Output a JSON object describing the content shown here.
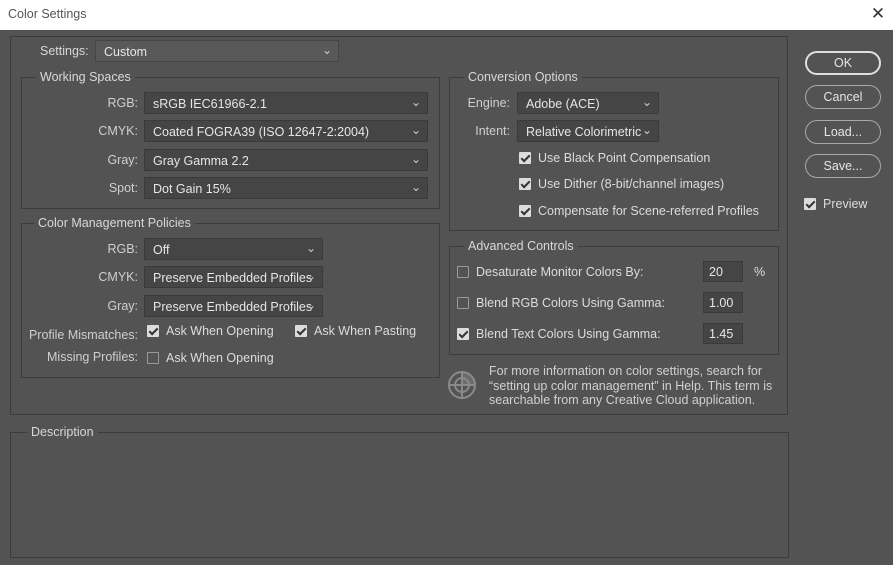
{
  "window": {
    "title": "Color Settings",
    "close_symbol": "✕"
  },
  "settings": {
    "label": "Settings:",
    "value": "Custom"
  },
  "working_spaces": {
    "title": "Working Spaces",
    "rgb": {
      "label": "RGB:",
      "value": "sRGB IEC61966-2.1"
    },
    "cmyk": {
      "label": "CMYK:",
      "value": "Coated FOGRA39 (ISO 12647-2:2004)"
    },
    "gray": {
      "label": "Gray:",
      "value": "Gray Gamma 2.2"
    },
    "spot": {
      "label": "Spot:",
      "value": "Dot Gain 15%"
    }
  },
  "policies": {
    "title": "Color Management Policies",
    "rgb": {
      "label": "RGB:",
      "value": "Off"
    },
    "cmyk": {
      "label": "CMYK:",
      "value": "Preserve Embedded Profiles"
    },
    "gray": {
      "label": "Gray:",
      "value": "Preserve Embedded Profiles"
    },
    "mismatches": {
      "label": "Profile Mismatches:",
      "opening": "Ask When Opening",
      "opening_checked": true,
      "pasting": "Ask When Pasting",
      "pasting_checked": true
    },
    "missing": {
      "label": "Missing Profiles:",
      "opening": "Ask When Opening",
      "opening_checked": false
    }
  },
  "conversion": {
    "title": "Conversion Options",
    "engine": {
      "label": "Engine:",
      "value": "Adobe (ACE)"
    },
    "intent": {
      "label": "Intent:",
      "value": "Relative Colorimetric"
    },
    "black_point": {
      "label": "Use Black Point Compensation",
      "checked": true
    },
    "dither": {
      "label": "Use Dither (8-bit/channel images)",
      "checked": true
    },
    "scene": {
      "label": "Compensate for Scene-referred Profiles",
      "checked": true
    }
  },
  "advanced": {
    "title": "Advanced Controls",
    "desaturate": {
      "label": "Desaturate Monitor Colors By:",
      "value": "20",
      "unit": "%",
      "checked": false
    },
    "blend_rgb": {
      "label": "Blend RGB Colors Using Gamma:",
      "value": "1.00",
      "checked": false
    },
    "blend_text": {
      "label": "Blend Text Colors Using Gamma:",
      "value": "1.45",
      "checked": true
    }
  },
  "info": {
    "line1": "For more information on color settings, search for",
    "line2": "“setting up color management” in Help. This term is",
    "line3": "searchable from any Creative Cloud application."
  },
  "description": {
    "title": "Description"
  },
  "buttons": {
    "ok": "OK",
    "cancel": "Cancel",
    "load": "Load...",
    "save": "Save..."
  },
  "preview": {
    "label": "Preview",
    "checked": true
  },
  "chevron": "⌄",
  "colors": {
    "background": "#535353",
    "titlebar": "#ffffff",
    "field": "#454545",
    "border": "#3c3c3c"
  }
}
